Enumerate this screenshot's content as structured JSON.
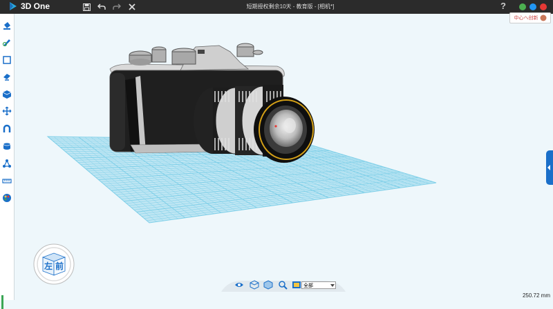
{
  "app": {
    "name": "3D One",
    "window_title": "短期授权剩余10天 - 教育版 - [相机*]"
  },
  "toolbar": {
    "icons": [
      "save-icon",
      "undo-icon",
      "redo-icon",
      "close-icon"
    ]
  },
  "window_controls": {
    "help": "?",
    "colors": [
      "#4caf50",
      "#2196f3",
      "#e53935"
    ]
  },
  "user_badge": {
    "text": "中心へ创新"
  },
  "sidebar": {
    "items": [
      "paint-bucket-icon",
      "sketch-icon",
      "rectangle-icon",
      "cube-cut-icon",
      "box-icon",
      "move-icon",
      "magnet-icon",
      "cylinder-icon",
      "node-icon",
      "measure-icon",
      "color-palette-icon"
    ]
  },
  "navcube": {
    "left_label": "左",
    "front_label": "前"
  },
  "bottom_bar": {
    "icons": [
      "eye-icon",
      "view-cube-icon",
      "shade-icon",
      "zoom-icon",
      "image-icon"
    ],
    "select_value": "全部"
  },
  "status": {
    "dimension": "250.72 mm"
  },
  "colors": {
    "accent": "#1a6fc9",
    "titlebar": "#2b2b2b",
    "grid": "#7ecfe8"
  }
}
